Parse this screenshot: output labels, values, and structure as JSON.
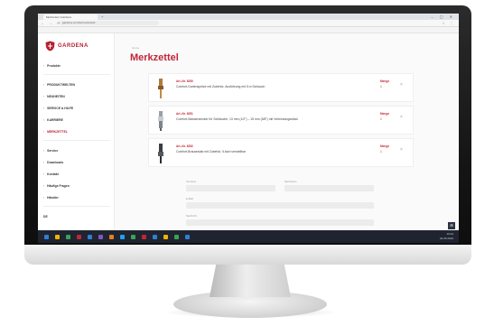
{
  "browser": {
    "tab_title": "Merkzettel | Gardena",
    "url": "gardena.com/de/merkzettel",
    "nav_icons": "← → ⟳",
    "tab_new": "+",
    "window_controls": "– ▢ ✕",
    "addr_icons": "☆ ⋮",
    "bookmarks": [
      {
        "label": "Apps",
        "color": "#4a89dc"
      },
      {
        "label": "Lesezeichen",
        "color": "#f0b400"
      },
      {
        "label": "Gmail",
        "color": "#d93025"
      },
      {
        "label": "YouTube",
        "color": "#e62117"
      },
      {
        "label": "Maps",
        "color": "#34a853"
      },
      {
        "label": "News",
        "color": "#4a89dc"
      },
      {
        "label": "Wetter",
        "color": "#f0b400"
      },
      {
        "label": "Übersetzer",
        "color": "#4a89dc"
      },
      {
        "label": "Drive",
        "color": "#34a853"
      },
      {
        "label": "Kalender",
        "color": "#4a89dc"
      },
      {
        "label": "Shopping",
        "color": "#d93025"
      },
      {
        "label": "Weitere",
        "color": "#777777"
      }
    ]
  },
  "brand": {
    "name": "GARDENA",
    "accent": "#c0263a"
  },
  "sidebar": {
    "items_top": [
      {
        "label": "Produkte",
        "active": false
      }
    ],
    "items_mid": [
      {
        "label": "PRODUKTWELTEN",
        "active": false
      },
      {
        "label": "NEUHEITEN",
        "active": false
      },
      {
        "label": "SERVICE & HILFE",
        "active": false
      },
      {
        "label": "KARRIERE",
        "active": false
      },
      {
        "label": "MERKZETTEL",
        "active": true
      }
    ],
    "items_bottom": [
      {
        "label": "Service",
        "active": false
      },
      {
        "label": "Downloads",
        "active": false
      },
      {
        "label": "Kontakt",
        "active": false
      },
      {
        "label": "Häufige Fragen",
        "active": false
      },
      {
        "label": "Händler",
        "active": false
      }
    ],
    "footer": "DE"
  },
  "main": {
    "breadcrumb": "Home",
    "title": "Merkzettel",
    "quantity_label": "Menge",
    "items": [
      {
        "art_no": "Art.-Nr. 8250",
        "description": "Comfort-Gartenspritze mit Zubehör, Ausführung mit 5 m Schlauch",
        "quantity": "1",
        "thumb": "brass"
      },
      {
        "art_no": "Art.-Nr. 8251",
        "description": "Comfort-Wasserstecker für Schläuche, 13 mm (1/2\") – 15 mm (5/8\") mit Verbindungsstück",
        "quantity": "1",
        "thumb": "silver"
      },
      {
        "art_no": "Art.-Nr. 8252",
        "description": "Comfort-Brausestab mit Zubehör, 5-fach verstellbar",
        "quantity": "1",
        "thumb": "dark"
      }
    ],
    "form": {
      "first_name_label": "Vorname",
      "last_name_label": "Nachname",
      "email_label": "E-Mail",
      "message_label": "Nachricht"
    }
  },
  "taskbar": {
    "time": "10:24",
    "date": "04.05.2019",
    "badge": "⊞",
    "icons": [
      "#2f7fd6",
      "#f0b400",
      "#3aa356",
      "#c0263a",
      "#2f7fd6",
      "#7e57c2",
      "#e67e22",
      "#1da1f2",
      "#3aa356",
      "#c0263a",
      "#2f7fd6",
      "#f0b400",
      "#3aa356",
      "#2f7fd6"
    ]
  }
}
